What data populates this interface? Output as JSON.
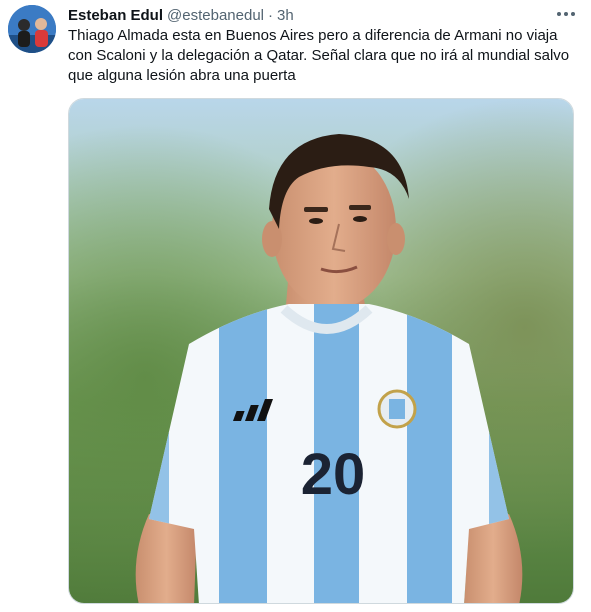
{
  "tweet": {
    "author_name": "Esteban Edul",
    "author_handle": "@estebanedul",
    "separator": "·",
    "time": "3h",
    "text": "Thiago Almada esta en Buenos Aires pero a diferencia de Armani no viaja\ncon Scaloni y la delegación a Qatar. Señal clara que no irá al mundial salvo\nque alguna lesión abra una puerta",
    "avatar_icon": "profile-avatar",
    "more_icon": "more-dots-icon",
    "media": {
      "jersey_number": "20",
      "shirt_brand_logo": "adidas-logo",
      "crest": "afa-crest"
    }
  },
  "colors": {
    "text_primary": "#0f1419",
    "text_secondary": "#536471",
    "border": "#cfd9de",
    "jersey_stripe": "#7ab4e2"
  }
}
